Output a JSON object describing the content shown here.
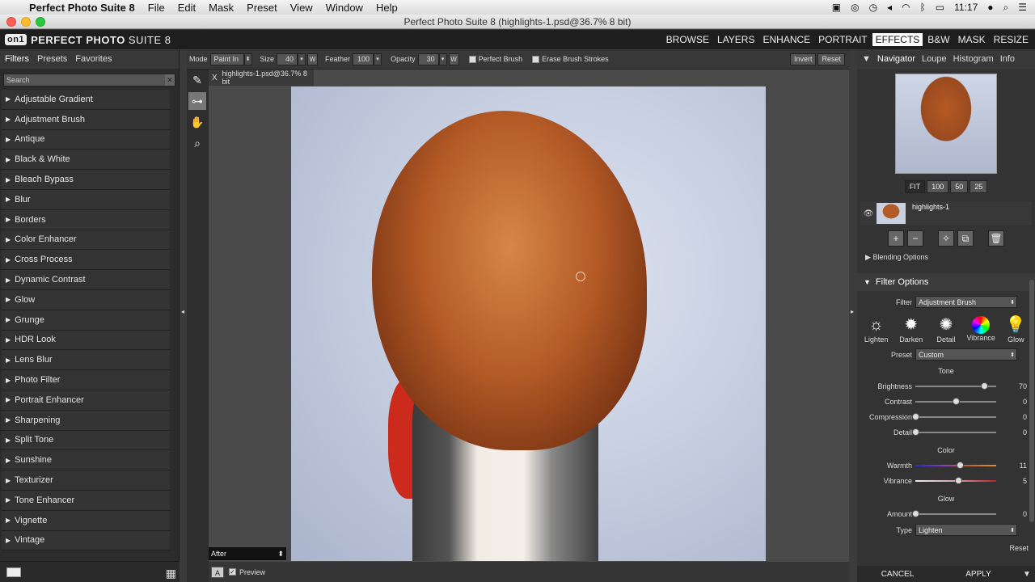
{
  "menubar": {
    "app_name": "Perfect Photo Suite 8",
    "items": [
      "File",
      "Edit",
      "Mask",
      "Preset",
      "View",
      "Window",
      "Help"
    ],
    "time": "11:17"
  },
  "window": {
    "title": "Perfect Photo Suite 8 (highlights-1.psd@36.7% 8 bit)"
  },
  "appbar": {
    "logo_mark": "on1",
    "logo_bold": "PERFECT PHOTO",
    "logo_thin": "SUITE 8",
    "modules": [
      "BROWSE",
      "LAYERS",
      "ENHANCE",
      "PORTRAIT",
      "EFFECTS",
      "B&W",
      "MASK",
      "RESIZE"
    ],
    "active_module": "EFFECTS"
  },
  "left": {
    "tabs": [
      "Filters",
      "Presets",
      "Favorites"
    ],
    "search_placeholder": "Search",
    "filters": [
      "Adjustable Gradient",
      "Adjustment Brush",
      "Antique",
      "Black & White",
      "Bleach Bypass",
      "Blur",
      "Borders",
      "Color Enhancer",
      "Cross Process",
      "Dynamic Contrast",
      "Glow",
      "Grunge",
      "HDR Look",
      "Lens Blur",
      "Photo Filter",
      "Portrait Enhancer",
      "Sharpening",
      "Split Tone",
      "Sunshine",
      "Texturizer",
      "Tone Enhancer",
      "Vignette",
      "Vintage"
    ]
  },
  "toolbar": {
    "mode_label": "Mode",
    "mode_value": "Paint In",
    "size_label": "Size",
    "size_value": "40",
    "feather_label": "Feather",
    "feather_value": "100",
    "opacity_label": "Opacity",
    "opacity_value": "30",
    "w": "W",
    "perfect_brush": "Perfect Brush",
    "erase_strokes": "Erase Brush Strokes",
    "invert": "Invert",
    "reset": "Reset"
  },
  "canvas": {
    "doc_tab": "highlights-1.psd@36.7% 8 bit",
    "close": "X",
    "view_mode": "After",
    "a_button": "A",
    "preview_label": "Preview"
  },
  "right": {
    "tabs": [
      "Navigator",
      "Loupe",
      "Histogram",
      "Info"
    ],
    "zooms": [
      "FIT",
      "100",
      "50",
      "25"
    ],
    "layer_name": "highlights-1",
    "blending_options": "Blending Options",
    "filter_options": "Filter Options",
    "filter_label": "Filter",
    "filter_value": "Adjustment Brush",
    "fx_icons": [
      "Lighten",
      "Darken",
      "Detail",
      "Vibrance",
      "Glow"
    ],
    "preset_label": "Preset",
    "preset_value": "Custom",
    "tone_header": "Tone",
    "tone_sliders": [
      {
        "label": "Brightness",
        "value": "70",
        "pos": 0.85
      },
      {
        "label": "Contrast",
        "value": "0",
        "pos": 0.5
      },
      {
        "label": "Compression",
        "value": "0",
        "pos": 0.0
      },
      {
        "label": "Detail",
        "value": "0",
        "pos": 0.0
      }
    ],
    "color_header": "Color",
    "color_sliders": [
      {
        "label": "Warmth",
        "value": "11",
        "pos": 0.55
      },
      {
        "label": "Vibrance",
        "value": "5",
        "pos": 0.53
      }
    ],
    "glow_header": "Glow",
    "glow_amount": {
      "label": "Amount",
      "value": "0",
      "pos": 0.0
    },
    "type_label": "Type",
    "type_value": "Lighten",
    "reset": "Reset",
    "cancel": "CANCEL",
    "apply": "APPLY"
  }
}
